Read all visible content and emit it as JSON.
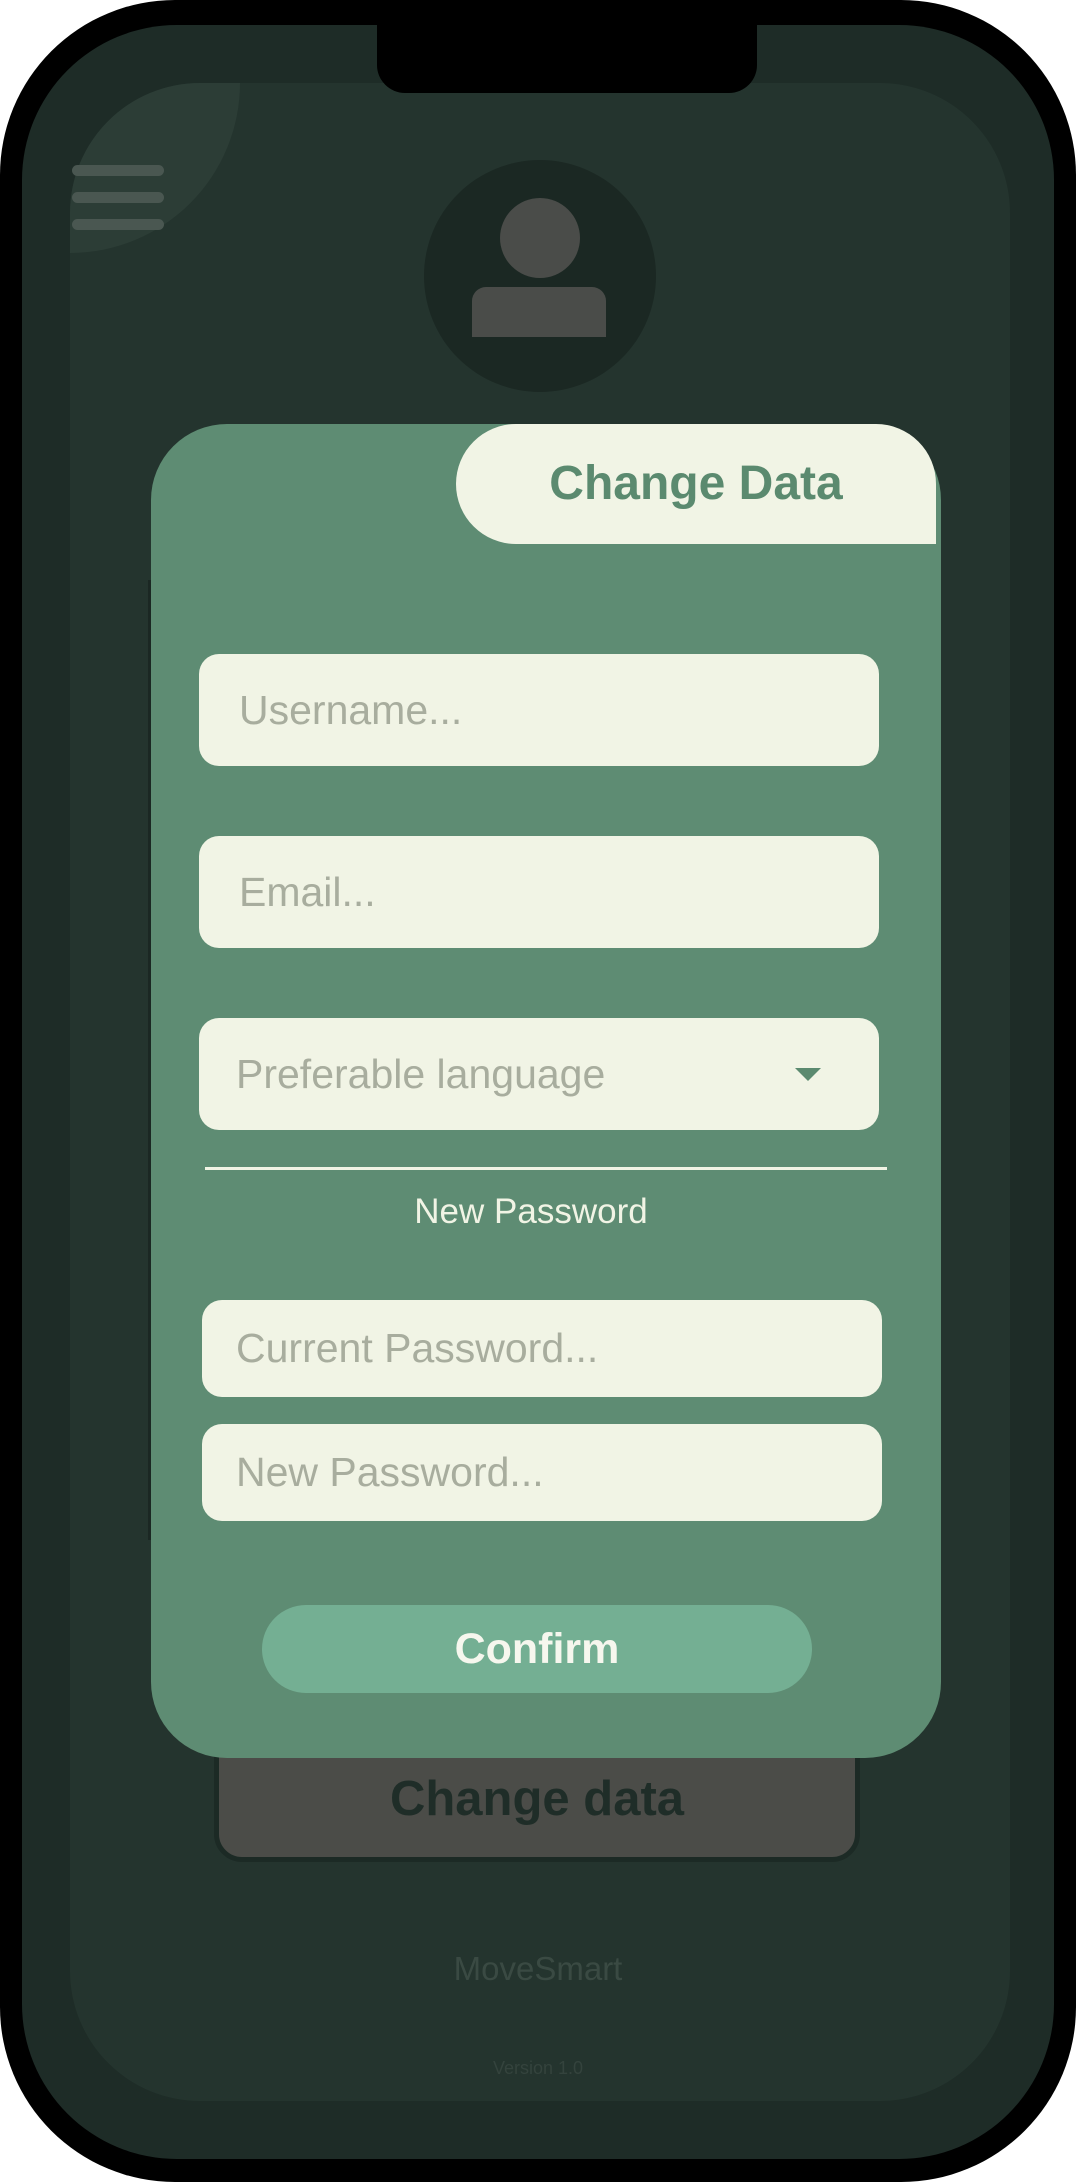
{
  "app": {
    "name": "MoveSmart",
    "version": "Version 1.0"
  },
  "header": {
    "menu_icon": "hamburger-menu-icon",
    "avatar_icon": "user-avatar-icon"
  },
  "background_button": {
    "label": "Change data"
  },
  "card": {
    "title": "Change Data",
    "fields": {
      "username_placeholder": "Username...",
      "email_placeholder": "Email...",
      "language_placeholder": "Preferable language",
      "language_icon": "chevron-down-icon",
      "section_label": "New Password",
      "current_password_placeholder": "Current Password...",
      "new_password_placeholder": "New Password..."
    },
    "confirm_label": "Confirm"
  },
  "colors": {
    "frame": "#1e2c27",
    "screen": "#24342e",
    "card": "#5e8c73",
    "field": "#f1f4e5",
    "accent": "#74af93",
    "tab_text": "#5b8a6f"
  }
}
